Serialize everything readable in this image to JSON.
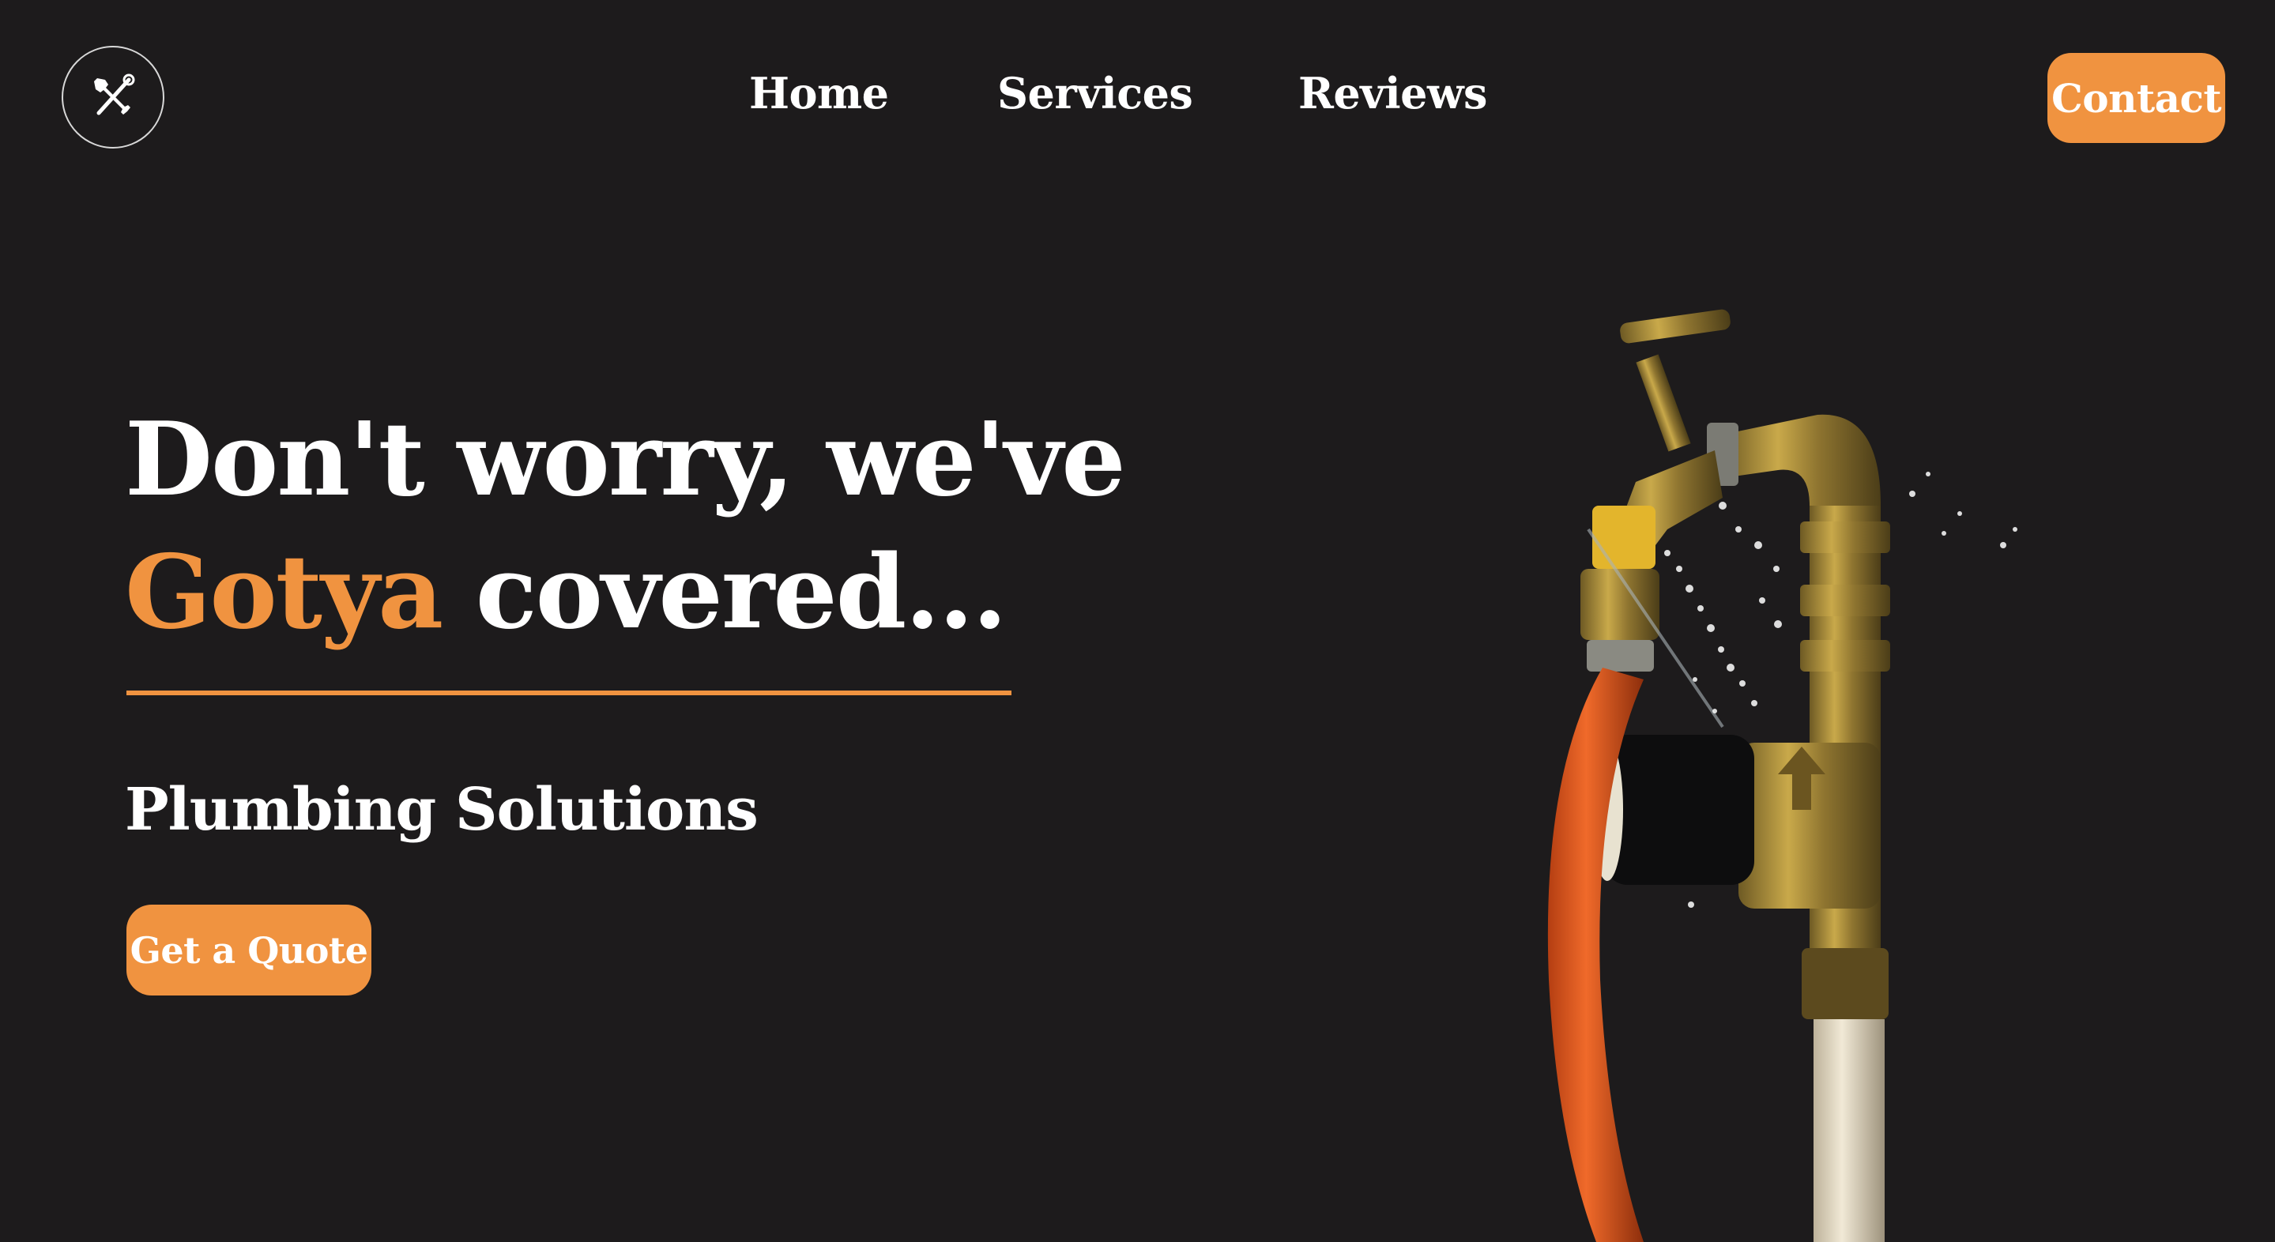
{
  "header": {
    "logo_icon": "wrench-and-screwdriver-icon",
    "nav": [
      {
        "label": "Home"
      },
      {
        "label": "Services"
      },
      {
        "label": "Reviews"
      }
    ],
    "contact_label": "Contact"
  },
  "hero": {
    "headline_line1": "Don't worry, we've",
    "headline_accent": "Gotya",
    "headline_rest": " covered...",
    "subtitle": "Plumbing Solutions",
    "cta_label": "Get a Quote"
  },
  "theme": {
    "background": "#1d1b1c",
    "accent": "#f09340",
    "text": "#ffffff"
  }
}
